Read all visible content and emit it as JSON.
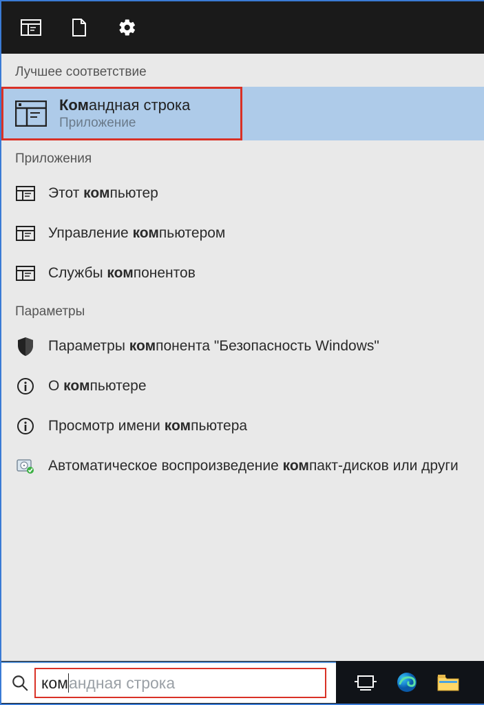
{
  "topbar": {
    "icons": [
      "apps-icon",
      "document-icon",
      "gear-icon"
    ]
  },
  "sections": {
    "best_match_label": "Лучшее соответствие",
    "apps_label": "Приложения",
    "settings_label": "Параметры"
  },
  "best_match": {
    "title_pre": "Ком",
    "title_rest": "андная строка",
    "subtitle": "Приложение"
  },
  "apps": [
    {
      "icon": "window-icon",
      "pre": "Этот ",
      "bold": "ком",
      "post": "пьютер"
    },
    {
      "icon": "window-icon",
      "pre": "Управление ",
      "bold": "ком",
      "post": "пьютером"
    },
    {
      "icon": "window-icon",
      "pre": "Службы ",
      "bold": "ком",
      "post": "понентов"
    }
  ],
  "settings": [
    {
      "icon": "shield-icon",
      "pre": "Параметры ",
      "bold": "ком",
      "post": "понента \"Безопасность Windows\""
    },
    {
      "icon": "info-icon",
      "pre": "О ",
      "bold": "ком",
      "post": "пьютере"
    },
    {
      "icon": "info-icon",
      "pre": "Просмотр имени ",
      "bold": "ком",
      "post": "пьютера"
    },
    {
      "icon": "disc-icon",
      "pre": "Автоматическое воспроизведение ",
      "bold": "ком",
      "post": "пакт-дисков или други"
    }
  ],
  "search": {
    "typed": "ком",
    "ghost": "андная строка"
  },
  "taskbar": {
    "icons": [
      "taskview-icon",
      "edge-icon",
      "explorer-icon"
    ]
  }
}
